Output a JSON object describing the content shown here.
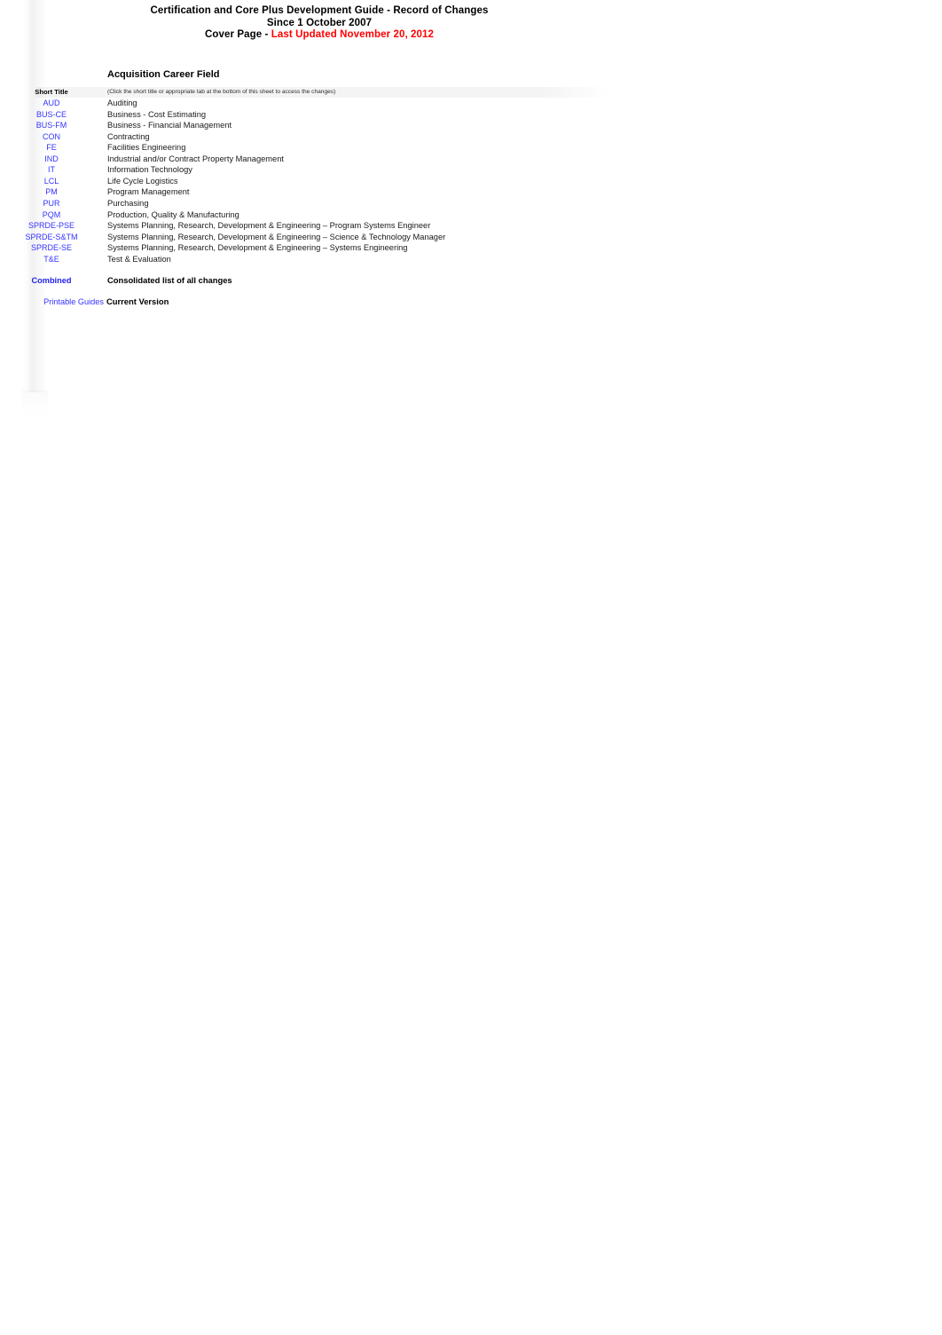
{
  "document": {
    "title_lines": [
      "Certification and Core Plus Development Guide - Record of Changes",
      "Since 1 October 2007"
    ],
    "cover_prefix": "Cover Page - ",
    "last_updated": "Last Updated November 20, 2012",
    "section_heading": "Acquisition Career Field",
    "colors": {
      "link_blue": "#3333FF",
      "accent_red": "#FF0000",
      "text_black": "#000000",
      "header_band": "#F2F2F2"
    }
  },
  "table": {
    "headers": {
      "short_title": "Short Title",
      "note": "(Click the short title or appropriate tab at the bottom of this sheet to access the changes)"
    },
    "rows": [
      {
        "short": "AUD",
        "desc": "Auditing"
      },
      {
        "short": "BUS-CE",
        "desc": "Business - Cost Estimating"
      },
      {
        "short": "BUS-FM",
        "desc": "Business - Financial Management"
      },
      {
        "short": "CON",
        "desc": "Contracting"
      },
      {
        "short": "FE",
        "desc": "Facilities Engineering"
      },
      {
        "short": "IND",
        "desc": "Industrial and/or Contract Property Management"
      },
      {
        "short": "IT",
        "desc": "Information Technology"
      },
      {
        "short": "LCL",
        "desc": "Life Cycle Logistics"
      },
      {
        "short": "PM",
        "desc": "Program Management"
      },
      {
        "short": "PUR",
        "desc": "Purchasing"
      },
      {
        "short": "PQM",
        "desc": "Production, Quality & Manufacturing"
      },
      {
        "short": "SPRDE-PSE",
        "desc": "Systems Planning, Research, Development & Engineering – Program Systems Engineer"
      },
      {
        "short": "SPRDE-S&TM",
        "desc": "Systems Planning, Research, Development & Engineering – Science & Technology Manager"
      },
      {
        "short": "SPRDE-SE",
        "desc": "Systems Planning, Research, Development & Engineering – Systems Engineering"
      },
      {
        "short": "T&E",
        "desc": "Test & Evaluation"
      }
    ],
    "footer_rows": [
      {
        "short": "Combined",
        "desc": "Consolidated list of all changes"
      },
      {
        "short": "Printable Guides",
        "desc": "Current Version"
      }
    ]
  }
}
